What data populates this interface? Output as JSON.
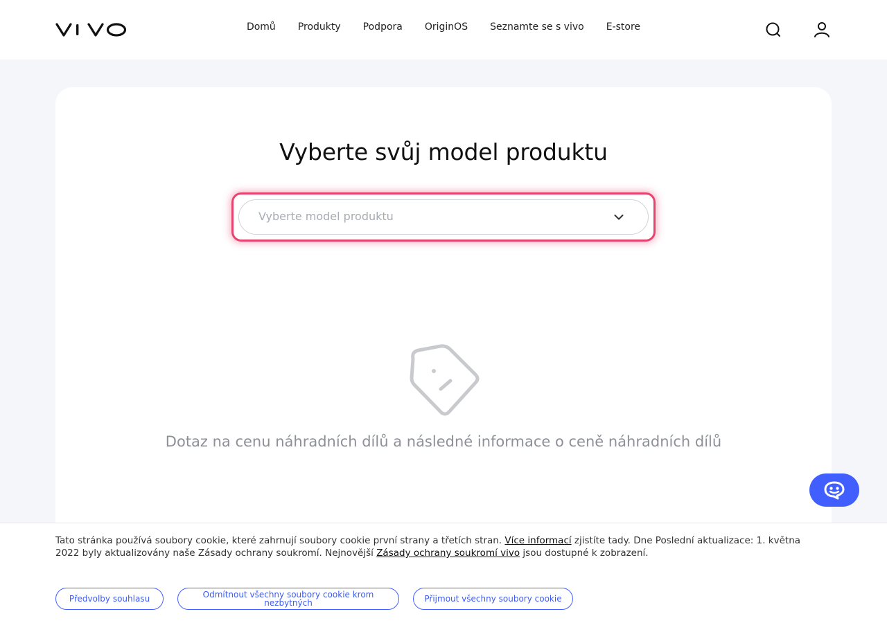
{
  "brand": {
    "logo_text": "vivo",
    "accent": "#415fff",
    "highlight": "#e8436f"
  },
  "nav": {
    "items": [
      {
        "label": "Domů"
      },
      {
        "label": "Produkty"
      },
      {
        "label": "Podpora"
      },
      {
        "label": "OriginOS"
      },
      {
        "label": "Seznamte se s vivo"
      },
      {
        "label": "E-store"
      }
    ],
    "icons": [
      "search-icon",
      "user-icon"
    ]
  },
  "main": {
    "title": "Vyberte svůj model produktu",
    "select": {
      "placeholder": "Vyberte model produktu",
      "icon": "chevron-down-icon"
    },
    "empty_state": {
      "icon": "price-tag-icon",
      "text": "Dotaz na cenu náhradních dílů a následné informace o ceně náhradních dílů"
    }
  },
  "chat": {
    "icon": "chat-bot-icon"
  },
  "cookie": {
    "text_1": "Tato stránka používá soubory cookie, které zahrnují soubory cookie první strany a třetích stran. ",
    "link_1": "Více informací",
    "text_2": " zjistíte tady. Dne Poslední aktualizace: 1. května 2022 byly aktualizovány naše Zásady ochrany soukromí. Nejnovější ",
    "link_2": "Zásady ochrany soukromí vivo",
    "text_3": " jsou dostupné k zobrazení.",
    "buttons": [
      {
        "label": "Předvolby souhlasu"
      },
      {
        "label": "Odmítnout všechny soubory cookie krom nezbytných"
      },
      {
        "label": "Přijmout všechny soubory cookie"
      }
    ]
  }
}
